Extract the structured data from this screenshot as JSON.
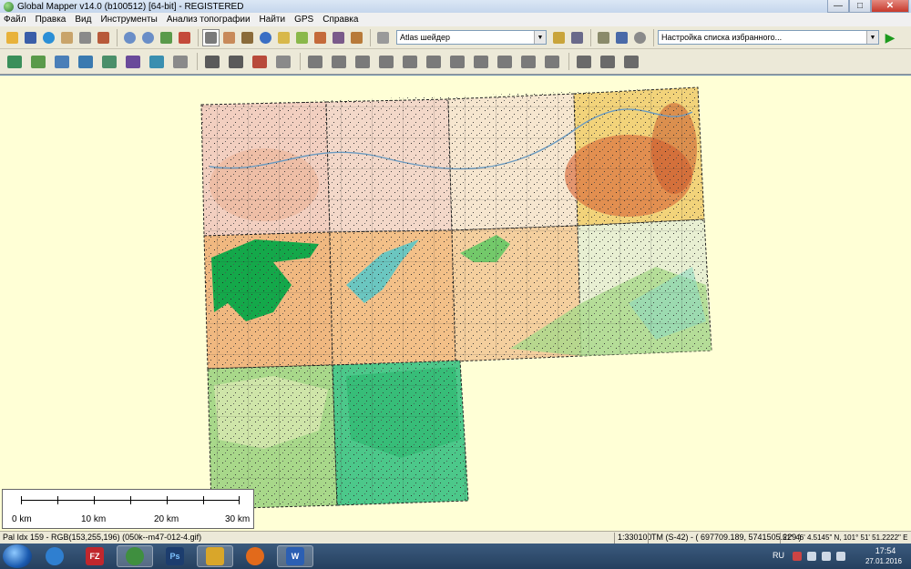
{
  "window": {
    "title": "Global Mapper v14.0 (b100512) [64-bit] - REGISTERED",
    "minimize": "—",
    "maximize": "□",
    "close": "✕"
  },
  "menu": {
    "items": [
      "Файл",
      "Правка",
      "Вид",
      "Инструменты",
      "Анализ топографии",
      "Найти",
      "GPS",
      "Справка"
    ]
  },
  "toolbar": {
    "shader_select": "Atlas шейдер",
    "favorites_select": "Настройка списка избранного...",
    "run_icon": "play-icon",
    "colors": {
      "folder": "#e8b23a",
      "save": "#3a5ea8",
      "globe": "#2b8fd6",
      "zoom": "#6a8ec7",
      "pan": "#8a6b3a",
      "draw": "#5a8f4a",
      "shape": "#7a7a7a"
    }
  },
  "map": {
    "background": "#ffffd6",
    "tile_colors": {
      "pink_relief": "#f2cfc0",
      "orange_relief": "#f0b880",
      "red_highlands": "#d86a3a",
      "yellow_plateau": "#f2d37a",
      "reservoir": "#14a84a",
      "river_cyan": "#5cc7c7",
      "lowland_green": "#4cc88a",
      "light_green": "#a8d88a"
    },
    "scale_bar": {
      "labels": [
        "0 km",
        "10 km",
        "20 km",
        "30 km"
      ]
    }
  },
  "status": {
    "palette_info": "Pal Idx 159 - RGB(153,255,196) (050k--m47-012-4.gif)",
    "scale": "1:330100",
    "projection": "TM (S-42) - ( 697709.189, 5741505.229 )",
    "geo_coords": "51° 46' 4.5145\" N, 101° 51' 51.2222\" E"
  },
  "taskbar": {
    "apps": [
      {
        "name": "google-earth",
        "label": "",
        "color": "#2f7fd0"
      },
      {
        "name": "filezilla",
        "label": "FZ",
        "color": "#c0272d"
      },
      {
        "name": "global-mapper",
        "label": "",
        "color": "#3f8f3f"
      },
      {
        "name": "photoshop",
        "label": "Ps",
        "color": "#1c3d6e"
      },
      {
        "name": "app-yellow",
        "label": "",
        "color": "#d9a62a"
      },
      {
        "name": "firefox",
        "label": "",
        "color": "#e26a1b"
      },
      {
        "name": "word",
        "label": "W",
        "color": "#2b5fb3"
      }
    ],
    "language": "RU",
    "time": "17:54",
    "date": "27.01.2016"
  }
}
